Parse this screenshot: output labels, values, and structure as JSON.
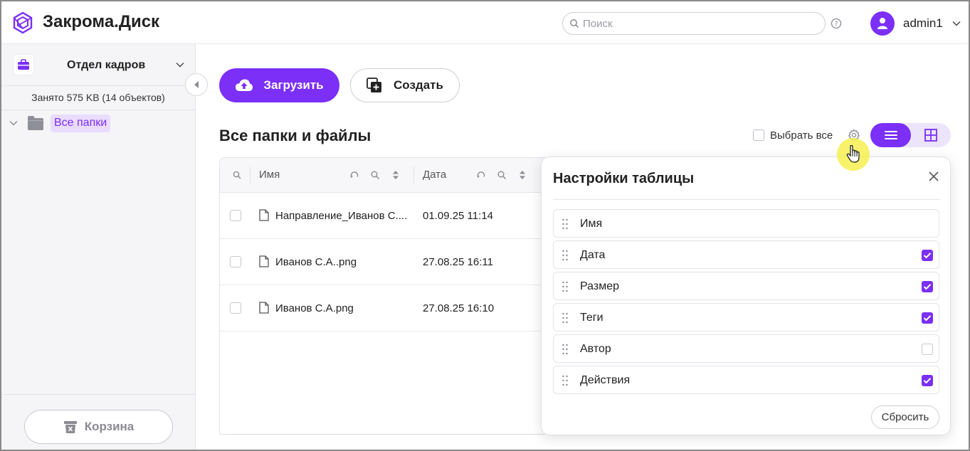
{
  "app": {
    "title": "Закрома.Диск"
  },
  "header": {
    "search_placeholder": "Поиск",
    "username": "admin1"
  },
  "sidebar": {
    "department": "Отдел кадров",
    "usage": "Занято 575 KB (14 объектов)",
    "tree": [
      {
        "label": "Все папки"
      }
    ],
    "trash_label": "Корзина"
  },
  "toolbar": {
    "upload_label": "Загрузить",
    "create_label": "Создать"
  },
  "main": {
    "section_title": "Все папки и файлы",
    "select_all_label": "Выбрать все",
    "view_mode": "list"
  },
  "table": {
    "columns": [
      "Имя",
      "Дата"
    ],
    "rows": [
      {
        "name": "Направление_Иванов С....",
        "date": "01.09.25 11:14"
      },
      {
        "name": "Иванов С.А..png",
        "date": "27.08.25 16:11"
      },
      {
        "name": "Иванов С.А.png",
        "date": "27.08.25 16:10"
      }
    ]
  },
  "settings_panel": {
    "title": "Настройки таблицы",
    "columns": [
      {
        "label": "Имя",
        "checked": null
      },
      {
        "label": "Дата",
        "checked": true
      },
      {
        "label": "Размер",
        "checked": true
      },
      {
        "label": "Теги",
        "checked": true
      },
      {
        "label": "Автор",
        "checked": false
      },
      {
        "label": "Действия",
        "checked": true
      }
    ],
    "reset_label": "Сбросить"
  },
  "colors": {
    "accent": "#7b2ff7",
    "accent_light": "#eadcff",
    "cursor_highlight": "#f6f050"
  }
}
